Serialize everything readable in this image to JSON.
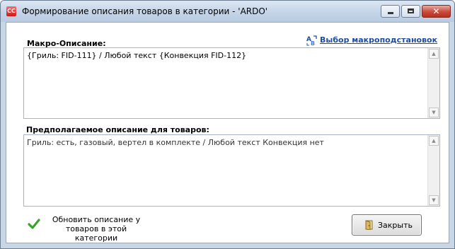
{
  "window": {
    "title": "Формирование описания товаров в категории - 'ARDO'",
    "app_icon_label": "CC",
    "close_glyph": "✕"
  },
  "macro": {
    "label": "Макро-Описание:",
    "value": "{Гриль: FID-111} / Любой текст {Конвекция FID-112}",
    "link_text": "Выбор макроподстановок"
  },
  "predicted": {
    "label": "Предполагаемое описание для товаров:",
    "value": "Гриль: есть, газовый, вертел в комплекте / Любой текст Конвекция нет"
  },
  "actions": {
    "update_label": "Обновить описание у товаров в этой категории",
    "close_label": "Закрыть"
  },
  "icons": {
    "app": "app-icon",
    "macro_link": "font-substitution-icon",
    "update": "checkmark-icon",
    "close": "close-door-icon",
    "scroll_up": "chevron-up-icon",
    "scroll_down": "chevron-down-icon"
  },
  "colors": {
    "link": "#1f4da3",
    "check": "#3aa12c",
    "titlebar": "#c8d7e9"
  }
}
